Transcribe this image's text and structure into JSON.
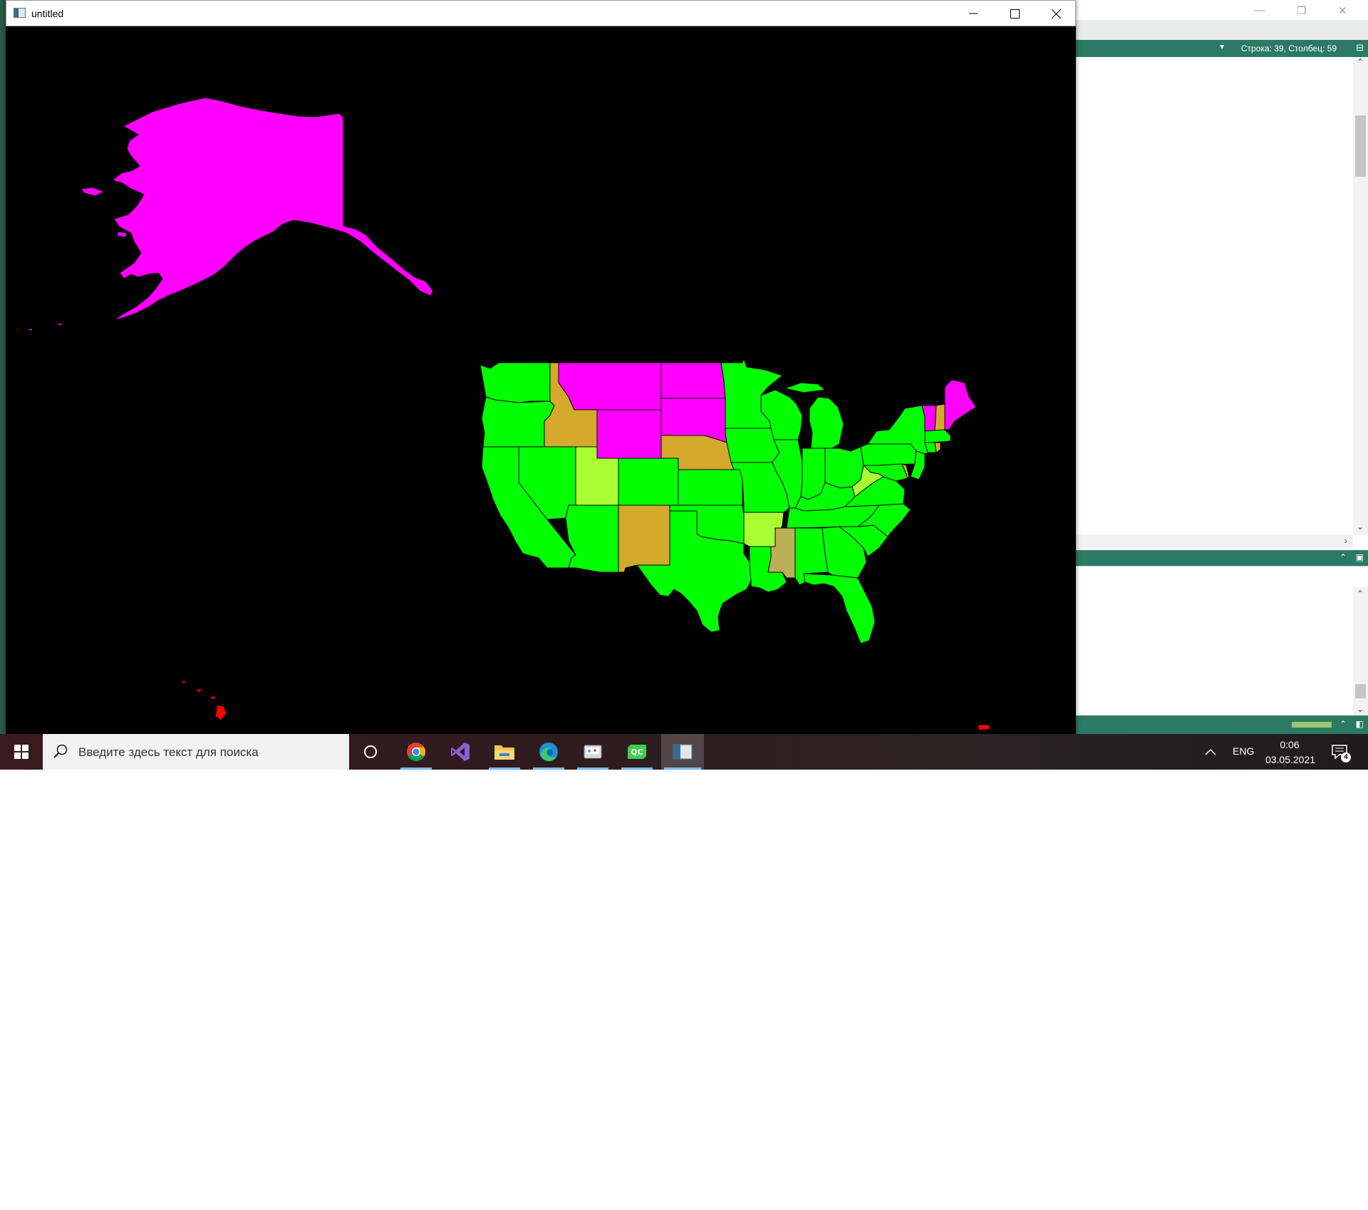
{
  "map_window": {
    "title": "untitled",
    "controls": {
      "minimize": "minimize",
      "maximize": "maximize",
      "close": "close"
    }
  },
  "map": {
    "background": "#000000",
    "state_border_color": "#000000",
    "colors": {
      "green": "#00ff00",
      "magenta": "#ff00ff",
      "gold": "#d4aa2d",
      "yellow_green": "#aaff33",
      "olive": "#bbb055",
      "red": "#ff0000"
    },
    "regions": [
      {
        "name": "Alaska",
        "color": "magenta"
      },
      {
        "name": "Hawaii",
        "color": "red"
      },
      {
        "name": "Puerto Rico",
        "color": "red"
      },
      {
        "name": "Washington",
        "color": "green"
      },
      {
        "name": "Oregon",
        "color": "green"
      },
      {
        "name": "California",
        "color": "green"
      },
      {
        "name": "Idaho",
        "color": "gold"
      },
      {
        "name": "Nevada",
        "color": "green"
      },
      {
        "name": "Utah",
        "color": "yellow_green"
      },
      {
        "name": "Arizona",
        "color": "green"
      },
      {
        "name": "Montana",
        "color": "magenta"
      },
      {
        "name": "Wyoming",
        "color": "magenta"
      },
      {
        "name": "Colorado",
        "color": "green"
      },
      {
        "name": "New Mexico",
        "color": "gold"
      },
      {
        "name": "North Dakota",
        "color": "magenta"
      },
      {
        "name": "South Dakota",
        "color": "magenta"
      },
      {
        "name": "Nebraska",
        "color": "gold"
      },
      {
        "name": "Kansas",
        "color": "green"
      },
      {
        "name": "Oklahoma",
        "color": "green"
      },
      {
        "name": "Texas",
        "color": "green"
      },
      {
        "name": "Minnesota",
        "color": "green"
      },
      {
        "name": "Iowa",
        "color": "green"
      },
      {
        "name": "Missouri",
        "color": "green"
      },
      {
        "name": "Arkansas",
        "color": "yellow_green"
      },
      {
        "name": "Louisiana",
        "color": "green"
      },
      {
        "name": "Wisconsin",
        "color": "green"
      },
      {
        "name": "Illinois",
        "color": "green"
      },
      {
        "name": "Michigan",
        "color": "green"
      },
      {
        "name": "Indiana",
        "color": "green"
      },
      {
        "name": "Ohio",
        "color": "green"
      },
      {
        "name": "Kentucky",
        "color": "green"
      },
      {
        "name": "Tennessee",
        "color": "green"
      },
      {
        "name": "Mississippi",
        "color": "olive"
      },
      {
        "name": "Alabama",
        "color": "green"
      },
      {
        "name": "Georgia",
        "color": "green"
      },
      {
        "name": "Florida",
        "color": "green"
      },
      {
        "name": "South Carolina",
        "color": "green"
      },
      {
        "name": "North Carolina",
        "color": "green"
      },
      {
        "name": "Virginia",
        "color": "green"
      },
      {
        "name": "West Virginia",
        "color": "yellow_green"
      },
      {
        "name": "Pennsylvania",
        "color": "green"
      },
      {
        "name": "New York",
        "color": "green"
      },
      {
        "name": "Maryland",
        "color": "green"
      },
      {
        "name": "Delaware",
        "color": "gold"
      },
      {
        "name": "New Jersey",
        "color": "green"
      },
      {
        "name": "Vermont",
        "color": "magenta"
      },
      {
        "name": "New Hampshire",
        "color": "gold"
      },
      {
        "name": "Maine",
        "color": "magenta"
      },
      {
        "name": "Massachusetts",
        "color": "green"
      },
      {
        "name": "Connecticut",
        "color": "green"
      },
      {
        "name": "Rhode Island",
        "color": "gold"
      }
    ]
  },
  "editor": {
    "status_position": "Строка: 39, Столбец: 59"
  },
  "taskbar": {
    "search_placeholder": "Введите здесь текст для поиска",
    "apps": [
      {
        "name": "chrome-icon"
      },
      {
        "name": "visual-studio-icon"
      },
      {
        "name": "file-explorer-icon"
      },
      {
        "name": "edge-icon"
      },
      {
        "name": "paint-icon"
      },
      {
        "name": "qt-creator-icon",
        "label": "QC"
      },
      {
        "name": "untitled-app-icon"
      }
    ],
    "language": "ENG",
    "time": "0:06",
    "date": "03.05.2021",
    "notifications_count": "4"
  }
}
